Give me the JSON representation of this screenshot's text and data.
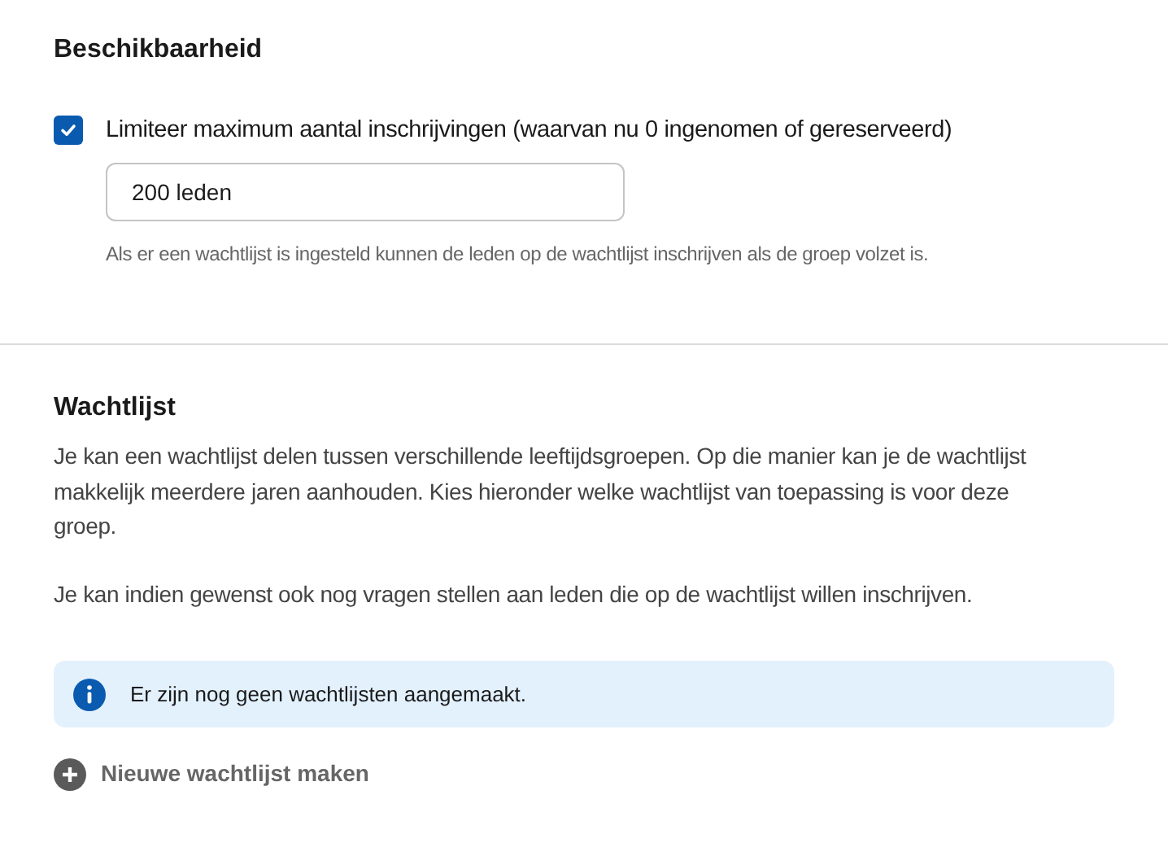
{
  "availability": {
    "title": "Beschikbaarheid",
    "limit_checkbox": {
      "label": "Limiteer maximum aantal inschrijvingen (waarvan nu 0 ingenomen of gereserveerd)",
      "checked": true
    },
    "limit_field": {
      "value": "200 leden"
    },
    "help": "Als er een wachtlijst is ingesteld kunnen de leden op de wachtlijst inschrijven als de groep volzet is."
  },
  "waitlist": {
    "title": "Wachtlijst",
    "paragraphs": [
      "Je kan een wachtlijst delen tussen verschillende leeftijdsgroepen. Op die manier kan je de wachtlijst makkelijk meerdere jaren aanhouden. Kies hieronder welke wachtlijst van toepassing is voor deze groep.",
      "Je kan indien gewenst ook nog vragen stellen aan leden die op de wachtlijst willen inschrijven."
    ],
    "info": "Er zijn nog geen wachtlijsten aangemaakt.",
    "add_button": "Nieuwe wachtlijst maken"
  }
}
